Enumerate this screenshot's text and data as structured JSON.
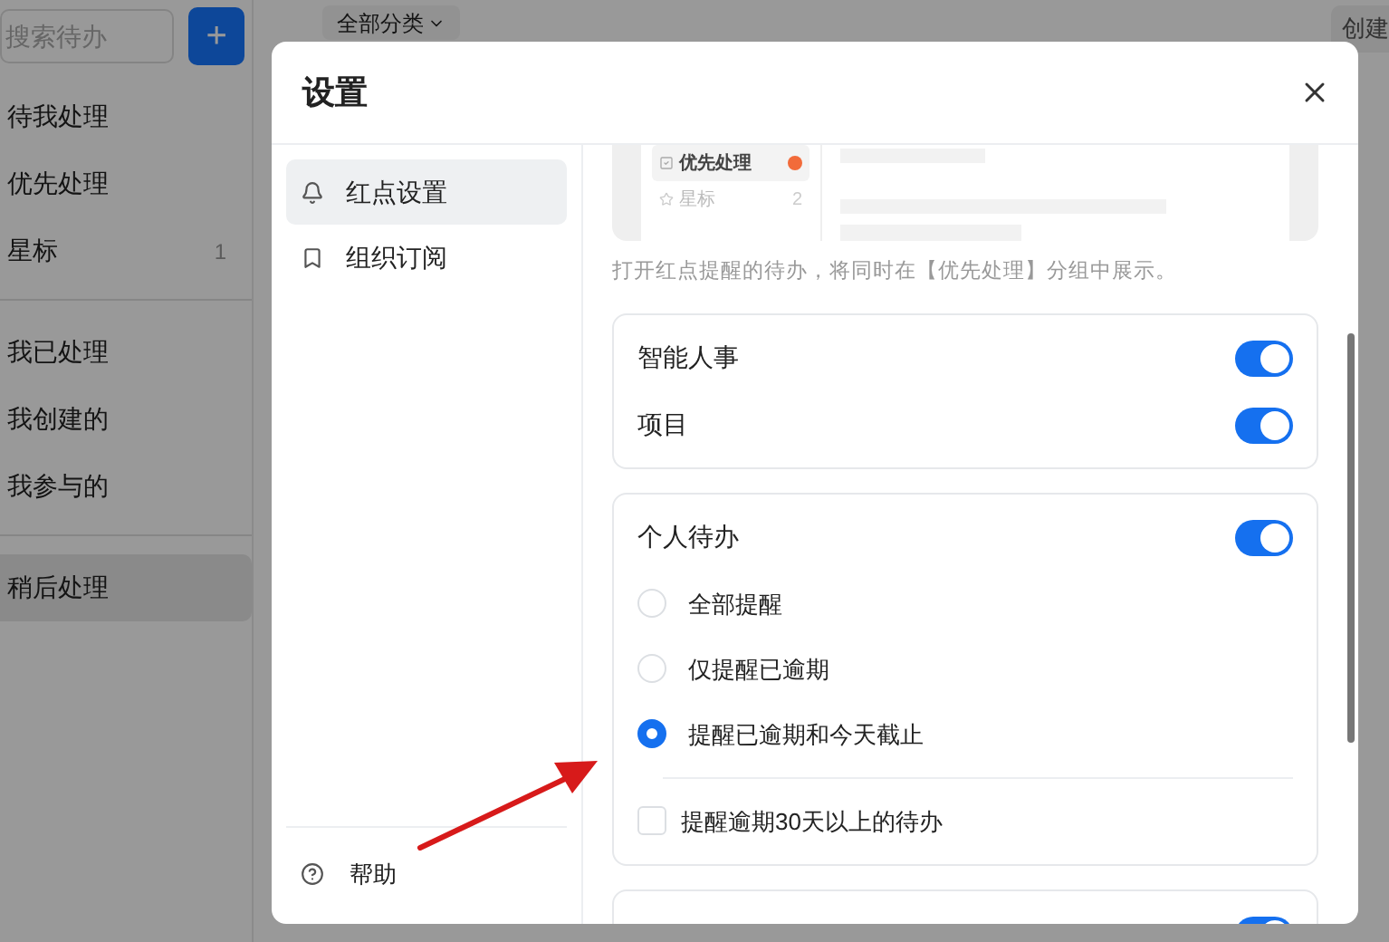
{
  "app": {
    "search": {
      "placeholder": "搜索待办"
    },
    "add_button": "+",
    "filter": "全部分类",
    "create_button": "创建",
    "nav_groups": [
      {
        "items": [
          {
            "label": "待我处理",
            "selected": false
          },
          {
            "label": "优先处理",
            "selected": false
          },
          {
            "label": "星标",
            "count": "1",
            "selected": false
          }
        ]
      },
      {
        "items": [
          {
            "label": "我已处理",
            "selected": false
          },
          {
            "label": "我创建的",
            "selected": false
          },
          {
            "label": "我参与的",
            "selected": false
          }
        ]
      },
      {
        "items": [
          {
            "label": "稍后处理",
            "selected": true
          }
        ]
      }
    ]
  },
  "dialog": {
    "title": "设置",
    "menu": [
      {
        "label": "红点设置",
        "kind": "bell",
        "selected": true
      },
      {
        "label": "组织订阅",
        "kind": "bookmark",
        "selected": false
      }
    ],
    "help": "帮助",
    "preview": {
      "items": [
        {
          "label": "优先处理",
          "kind": "badge",
          "selected": true
        },
        {
          "label": "星标",
          "kind": "count",
          "count": "2",
          "selected": false
        }
      ]
    },
    "caption": "打开红点提醒的待办，将同时在【优先处理】分组中展示。",
    "cards": [
      {
        "rows": [
          {
            "kind": "toggle",
            "label": "智能人事",
            "on": true
          },
          {
            "kind": "toggle",
            "label": "项目",
            "on": true
          }
        ]
      },
      {
        "rows": [
          {
            "kind": "toggle",
            "label": "个人待办",
            "on": true
          },
          {
            "kind": "radio",
            "label": "全部提醒",
            "selected": false
          },
          {
            "kind": "radio",
            "label": "仅提醒已逾期",
            "selected": false
          },
          {
            "kind": "radio",
            "label": "提醒已逾期和今天截止",
            "selected": true
          },
          {
            "kind": "checkbox",
            "label": "提醒逾期30天以上的待办",
            "checked": false
          }
        ]
      },
      {
        "rows": [
          {
            "kind": "toggle",
            "on": true
          }
        ]
      }
    ]
  }
}
